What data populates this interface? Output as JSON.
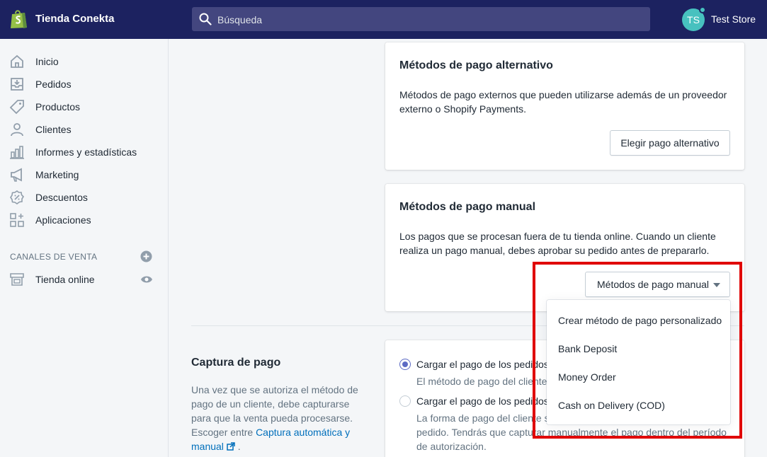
{
  "topbar": {
    "store_name": "Tienda Conekta",
    "search_placeholder": "Búsqueda",
    "avatar_initials": "TS",
    "account_name": "Test Store"
  },
  "sidebar": {
    "items": [
      {
        "label": "Inicio",
        "icon": "home-icon"
      },
      {
        "label": "Pedidos",
        "icon": "orders-icon"
      },
      {
        "label": "Productos",
        "icon": "tag-icon"
      },
      {
        "label": "Clientes",
        "icon": "person-icon"
      },
      {
        "label": "Informes y estadísticas",
        "icon": "bar-chart-icon"
      },
      {
        "label": "Marketing",
        "icon": "megaphone-icon"
      },
      {
        "label": "Descuentos",
        "icon": "discount-icon"
      },
      {
        "label": "Aplicaciones",
        "icon": "apps-icon"
      }
    ],
    "sales_channels_label": "CANALES DE VENTA",
    "channel": {
      "label": "Tienda online",
      "icon": "store-icon"
    }
  },
  "alt_card": {
    "title": "Métodos de pago alternativo",
    "text": "Métodos de pago externos que pueden utilizarse además de un proveedor externo o Shopify Payments.",
    "button": "Elegir pago alternativo"
  },
  "manual_card": {
    "title": "Métodos de pago manual",
    "text": "Los pagos que se procesan fuera de tu tienda online. Cuando un cliente realiza un pago manual, debes aprobar su pedido antes de prepararlo.",
    "button": "Métodos de pago manual"
  },
  "dropdown": {
    "items": [
      "Crear método de pago personalizado",
      "Bank Deposit",
      "Money Order",
      "Cash on Delivery (COD)"
    ]
  },
  "capture": {
    "title": "Captura de pago",
    "desc": "Una vez que se autoriza el método de pago de un cliente, debe capturarse para que la venta pueda procesarse. Escoger entre ",
    "link": "Captura automática y manual",
    "desc_end": " .",
    "option1_label": "Cargar el pago de los pedidos",
    "option1_help": "El método de pago del cliente",
    "option2_label": "Cargar el pago de los pedidos",
    "option2_help_line1": "La forma de pago del cliente s",
    "option2_help_line2": "pedido. Tendrás que capturar manualmente el pago dentro del período",
    "option2_help_line3": "de autorización.",
    "option1_checked": true
  },
  "colors": {
    "topbar": "#1c2260",
    "accent": "#5c6ac4",
    "highlight": "#e00000"
  }
}
